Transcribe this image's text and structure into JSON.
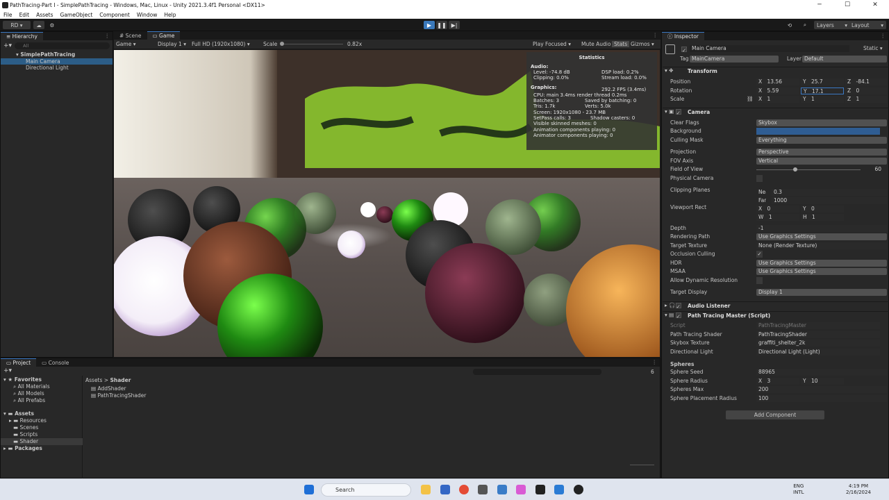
{
  "window": {
    "title": "PathTracing-Part I - SimplePathTracing - Windows, Mac, Linux - Unity 2021.3.4f1 Personal <DX11>",
    "controls": [
      "─",
      "☐",
      "✕"
    ]
  },
  "menu": [
    "File",
    "Edit",
    "Assets",
    "GameObject",
    "Component",
    "Window",
    "Help"
  ],
  "toolbar": {
    "account": "RD ▾",
    "layers": "Layers",
    "layout": "Layout"
  },
  "hierarchy": {
    "tab": "Hierarchy",
    "search_placeholder": "All",
    "scene": "SimplePathTracing",
    "items": [
      "Main Camera",
      "Directional Light"
    ]
  },
  "game_tabs": [
    "Scene",
    "Game"
  ],
  "game_bar": {
    "view": "Game",
    "display": "Display 1",
    "resolution": "Full HD (1920x1080)",
    "scale_label": "Scale",
    "scale_value": "0.82x",
    "play_mode": "Play Focused",
    "mute": "Mute Audio",
    "stats": "Stats",
    "gizmos": "Gizmos"
  },
  "stats": {
    "title": "Statistics",
    "audio_label": "Audio:",
    "level": "Level: -74.8 dB",
    "dsp": "DSP load: 0.2%",
    "clipping": "Clipping: 0.0%",
    "stream": "Stream load: 0.0%",
    "graphics_label": "Graphics:",
    "fps": "292.2 FPS (3.4ms)",
    "cpu": "CPU: main 3.4ms  render thread 0.2ms",
    "batches": "Batches: 3",
    "saved": "Saved by batching: 0",
    "tris": "Tris: 1.7k",
    "verts": "Verts: 5.0k",
    "screen": "Screen: 1920x1080 - 23.7 MB",
    "setpass": "SetPass calls: 3",
    "shadow": "Shadow casters: 0",
    "skinned": "Visible skinned meshes: 0",
    "anim": "Animation components playing: 0",
    "animator": "Animator components playing: 0"
  },
  "inspector": {
    "tab": "Inspector",
    "object": "Main Camera",
    "static": "Static",
    "tag_label": "Tag",
    "tag": "MainCamera",
    "layer_label": "Layer",
    "layer": "Default",
    "transform": {
      "title": "Transform",
      "position_label": "Position",
      "pos": [
        "13.56",
        "25.7",
        "-84.1"
      ],
      "rotation_label": "Rotation",
      "rot": [
        "5.59",
        "17.1",
        "0"
      ],
      "scale_label": "Scale",
      "scale": [
        "1",
        "1",
        "1"
      ]
    },
    "camera": {
      "title": "Camera",
      "rows": [
        {
          "label": "Clear Flags",
          "value": "Skybox"
        },
        {
          "label": "Background",
          "value": ""
        },
        {
          "label": "Culling Mask",
          "value": "Everything"
        },
        {
          "label": "Projection",
          "value": "Perspective"
        },
        {
          "label": "FOV Axis",
          "value": "Vertical"
        },
        {
          "label": "Field of View",
          "value": "60"
        },
        {
          "label": "Physical Camera",
          "value": ""
        },
        {
          "label": "Clipping Planes",
          "value": ""
        },
        {
          "label": "Viewport Rect",
          "value": ""
        },
        {
          "label": "Depth",
          "value": "-1"
        },
        {
          "label": "Rendering Path",
          "value": "Use Graphics Settings"
        },
        {
          "label": "Target Texture",
          "value": "None (Render Texture)"
        },
        {
          "label": "Occlusion Culling",
          "value": "✓"
        },
        {
          "label": "HDR",
          "value": "Use Graphics Settings"
        },
        {
          "label": "MSAA",
          "value": "Use Graphics Settings"
        },
        {
          "label": "Allow Dynamic Resolution",
          "value": ""
        },
        {
          "label": "Target Display",
          "value": "Display 1"
        }
      ],
      "near_label": "Near",
      "near": "0.3",
      "far_label": "Far",
      "far": "1000",
      "vp": {
        "x": "0",
        "y": "0",
        "w": "1",
        "h": "1"
      },
      "background_color": "#2f5d93"
    },
    "audio_listener": "Audio Listener",
    "ptm": {
      "title": "Path Tracing Master (Script)",
      "script_label": "Script",
      "script": "PathTracingMaster",
      "shader_label": "Path Tracing Shader",
      "shader": "PathTracingShader",
      "skybox_label": "Skybox Texture",
      "skybox": "graffiti_shelter_2k",
      "light_label": "Directional Light",
      "light": "Directional Light (Light)",
      "spheres_header": "Spheres",
      "seed_label": "Sphere Seed",
      "seed": "88965",
      "radius_label": "Sphere Radius",
      "radius_x": "3",
      "radius_y": "10",
      "max_label": "Spheres Max",
      "max": "200",
      "placement_label": "Sphere Placement Radius",
      "placement": "100"
    },
    "add_component": "Add Component"
  },
  "project": {
    "tabs": [
      "Project",
      "Console"
    ],
    "favorites": "Favorites",
    "fav_items": [
      "All Materials",
      "All Models",
      "All Prefabs"
    ],
    "assets": "Assets",
    "asset_folders": [
      "Resources",
      "Scenes",
      "Scripts",
      "Shader"
    ],
    "packages": "Packages",
    "breadcrumb": [
      "Assets",
      "Shader"
    ],
    "files": [
      "AddShader",
      "PathTracingShader"
    ],
    "count": "6"
  },
  "taskbar": {
    "search": "Search",
    "lang1": "ENG",
    "lang2": "INTL",
    "time": "4:19 PM",
    "date": "2/16/2024"
  }
}
